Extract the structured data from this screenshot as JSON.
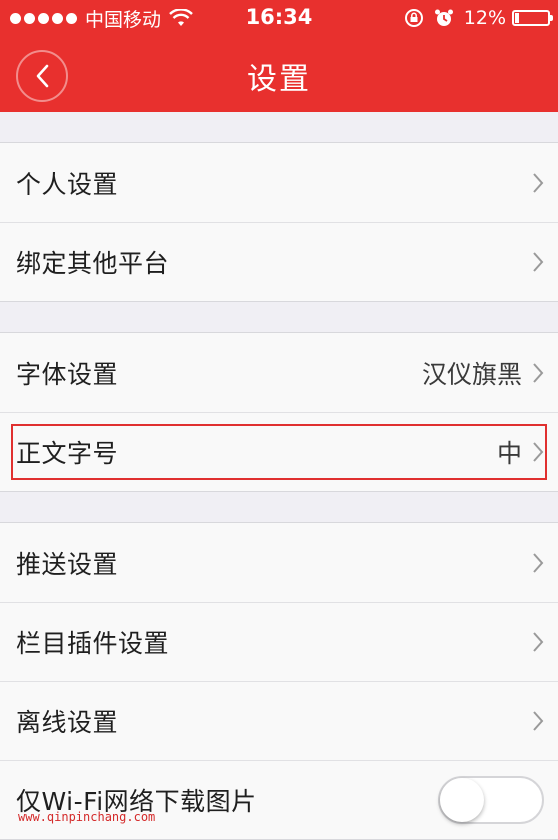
{
  "status_bar": {
    "carrier": "中国移动",
    "time": "16:34",
    "battery": "12%",
    "battery_level": 0.12,
    "icons": [
      "signal-dots-icon",
      "wifi-icon",
      "rotation-lock-icon",
      "alarm-icon",
      "battery-icon"
    ]
  },
  "header": {
    "title": "设置",
    "back_icon": "chevron-left-icon"
  },
  "colors": {
    "brand": "#e8302e",
    "highlight": "#e0302f"
  },
  "groups": [
    {
      "items": [
        {
          "label": "个人设置",
          "value": ""
        },
        {
          "label": "绑定其他平台",
          "value": ""
        }
      ]
    },
    {
      "items": [
        {
          "label": "字体设置",
          "value": "汉仪旗黑"
        },
        {
          "label": "正文字号",
          "value": "中"
        }
      ]
    },
    {
      "items": [
        {
          "label": "推送设置",
          "value": ""
        },
        {
          "label": "栏目插件设置",
          "value": ""
        },
        {
          "label": "离线设置",
          "value": ""
        },
        {
          "label": "仅Wi-Fi网络下载图片",
          "value": "",
          "toggle_on": false
        }
      ]
    }
  ],
  "watermark": "www.qinpinchang.com"
}
